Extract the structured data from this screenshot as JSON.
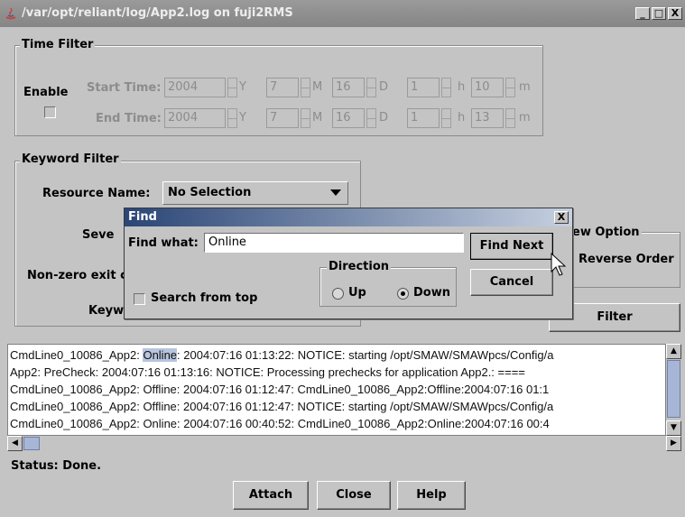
{
  "window": {
    "title": "/var/opt/reliant/log/App2.log on fuji2RMS",
    "min_label": "_",
    "max_label": "□",
    "close_label": "X"
  },
  "time_filter": {
    "title": "Time Filter",
    "enable_label": "Enable",
    "enabled": false,
    "start_label": "Start Time:",
    "end_label": "End Time:",
    "start": {
      "year": "2004",
      "month": "7",
      "day": "16",
      "hour": "1",
      "minute": "10"
    },
    "end": {
      "year": "2004",
      "month": "7",
      "day": "16",
      "hour": "1",
      "minute": "13"
    },
    "units": {
      "year": "Y",
      "month": "M",
      "day": "D",
      "hour": "h",
      "minute": "m"
    }
  },
  "keyword_filter": {
    "title": "Keyword Filter",
    "resource_label": "Resource Name:",
    "resource_value": "No Selection",
    "severity_label_partial": "Seve",
    "nonzero_label_partial": "Non-zero exit c",
    "keyword_label_partial": "Keyw"
  },
  "view_option": {
    "title_partial": "ew Option",
    "reverse_label": "Reverse Order",
    "filter_label": "Filter"
  },
  "find_dialog": {
    "title": "Find",
    "close_label": "X",
    "find_what_label": "Find what:",
    "find_what_value": "Online",
    "direction_title": "Direction",
    "up_label": "Up",
    "down_label": "Down",
    "direction_selected": "Down",
    "search_from_top_label": "Search from top",
    "search_from_top": false,
    "find_next_label": "Find Next",
    "cancel_label": "Cancel"
  },
  "log": {
    "lines": [
      {
        "pre": "CmdLine0_10086_App2: ",
        "hl": "Online",
        "post": ": 2004:07:16 01:13:22: NOTICE: starting /opt/SMAW/SMAWpcs/Config/a"
      },
      {
        "pre": "App2: PreCheck: 2004:07:16 01:13:16: NOTICE: Processing prechecks for application App2.: ====",
        "hl": "",
        "post": ""
      },
      {
        "pre": "CmdLine0_10086_App2: Offline: 2004:07:16 01:12:47: CmdLine0_10086_App2:Offline:2004:07:16 01:1",
        "hl": "",
        "post": ""
      },
      {
        "pre": "CmdLine0_10086_App2: Offline: 2004:07:16 01:12:47: NOTICE: starting /opt/SMAW/SMAWpcs/Config/a",
        "hl": "",
        "post": ""
      },
      {
        "pre": "CmdLine0_10086_App2: Online: 2004:07:16 00:40:52: CmdLine0_10086_App2:Online:2004:07:16 00:4",
        "hl": "",
        "post": ""
      }
    ]
  },
  "status": {
    "text": "Status: Done."
  },
  "buttons": {
    "attach": "Attach",
    "close": "Close",
    "help": "Help"
  },
  "colors": {
    "highlight": "#b7c5de",
    "dialog_title": "#2b4676",
    "background": "#c4c4c4"
  }
}
